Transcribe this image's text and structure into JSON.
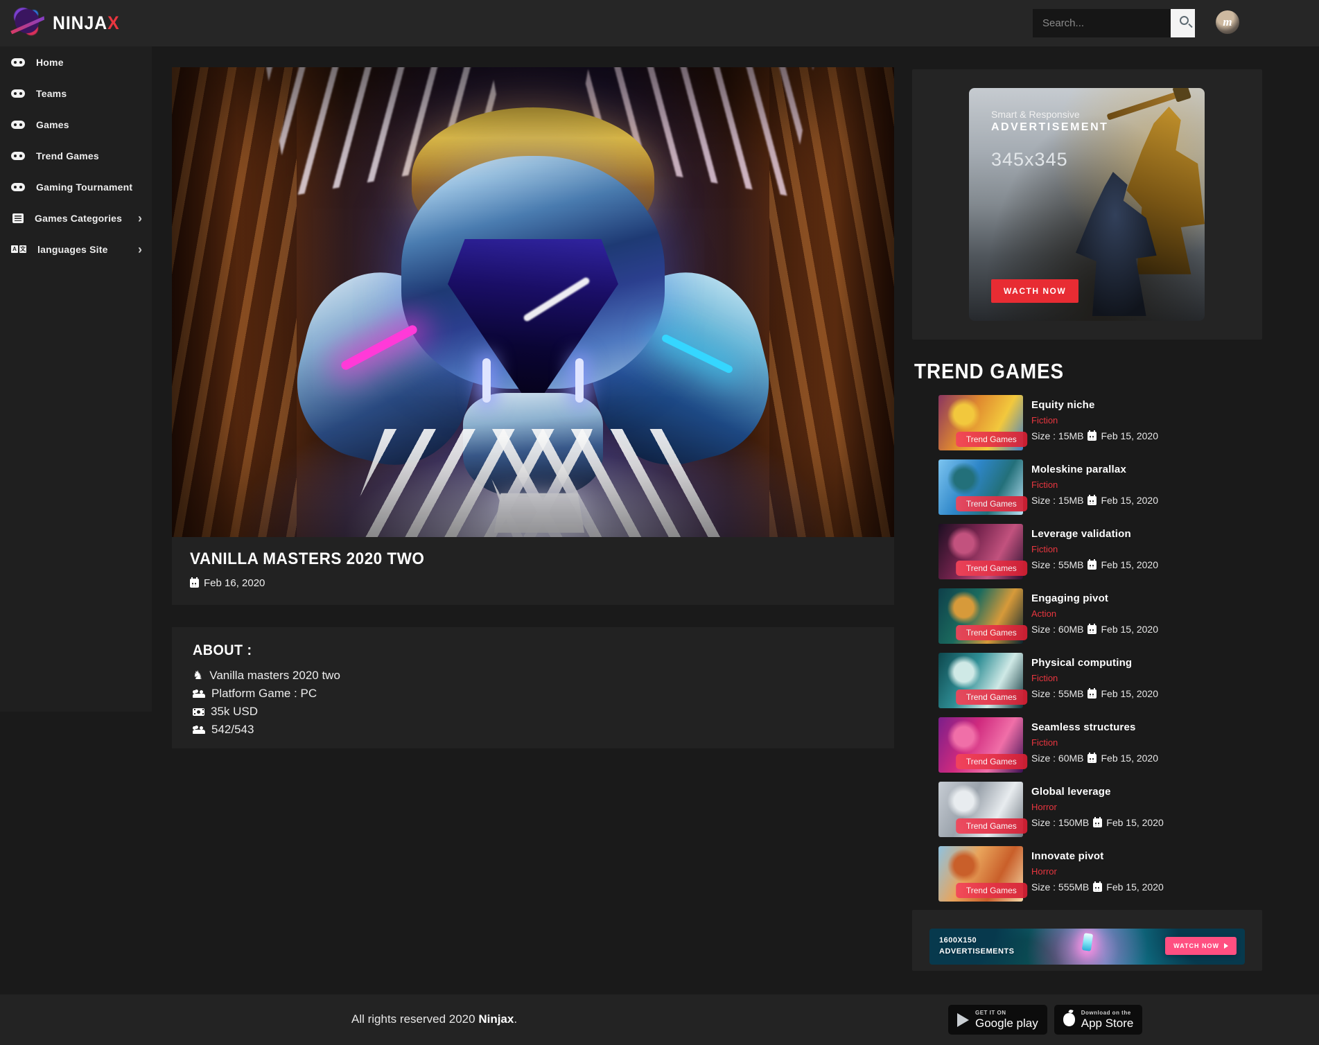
{
  "header": {
    "brand": {
      "text_main": "NINJA",
      "text_accent": "X"
    },
    "search_placeholder": "Search...",
    "avatar_initial": "m"
  },
  "sidebar": {
    "items": [
      {
        "label": "Home",
        "icon": "gamepad"
      },
      {
        "label": "Teams",
        "icon": "gamepad"
      },
      {
        "label": "Games",
        "icon": "gamepad"
      },
      {
        "label": "Trend Games",
        "icon": "gamepad"
      },
      {
        "label": "Gaming Tournament",
        "icon": "gamepad"
      },
      {
        "label": "Games Categories",
        "icon": "list",
        "has_submenu": true
      },
      {
        "label": "languages Site",
        "icon": "translate",
        "has_submenu": true
      }
    ]
  },
  "post": {
    "title": "VANILLA MASTERS 2020 TWO",
    "date": "Feb 16, 2020"
  },
  "about": {
    "heading": "ABOUT :",
    "rows": [
      {
        "icon": "chess-knight",
        "text": "Vanilla masters 2020 two"
      },
      {
        "icon": "users",
        "text": "Platform Game : PC"
      },
      {
        "icon": "money-bill",
        "text": "35k USD"
      },
      {
        "icon": "users",
        "text": "542/543"
      }
    ]
  },
  "ad": {
    "tagline": "Smart & Responsive",
    "title": "ADVERTISEMENT",
    "size_label": "345x345",
    "button": "WACTH NOW"
  },
  "trend": {
    "heading": "TREND GAMES",
    "badge": "Trend Games",
    "items": [
      {
        "title": "Equity niche",
        "genre": "Fiction",
        "size": "Size : 15MB",
        "date": "Feb 15, 2020",
        "colors": [
          "#8a3560",
          "#e08a2f",
          "#f2c83d",
          "#3f7fca"
        ]
      },
      {
        "title": "Moleskine parallax",
        "genre": "Fiction",
        "size": "Size : 15MB",
        "date": "Feb 15, 2020",
        "colors": [
          "#7cc4f0",
          "#2e86c8",
          "#23707a",
          "#b9e2f5"
        ]
      },
      {
        "title": "Leverage validation",
        "genre": "Fiction",
        "size": "Size : 55MB",
        "date": "Feb 15, 2020",
        "colors": [
          "#1c0f22",
          "#77244e",
          "#c2527e",
          "#2a1030"
        ]
      },
      {
        "title": "Engaging pivot",
        "genre": "Action",
        "size": "Size : 60MB",
        "date": "Feb 15, 2020",
        "colors": [
          "#0e3f4a",
          "#1b6b5e",
          "#d79a3a",
          "#082530"
        ]
      },
      {
        "title": "Physical computing",
        "genre": "Fiction",
        "size": "Size : 55MB",
        "date": "Feb 15, 2020",
        "colors": [
          "#0d474d",
          "#2f8e95",
          "#cfe9e6",
          "#0a3238"
        ]
      },
      {
        "title": "Seamless structures",
        "genre": "Fiction",
        "size": "Size : 60MB",
        "date": "Feb 15, 2020",
        "colors": [
          "#7a1f8a",
          "#d02a7e",
          "#f06fa8",
          "#3a0f52"
        ]
      },
      {
        "title": "Global leverage",
        "genre": "Horror",
        "size": "Size : 150MB",
        "date": "Feb 15, 2020",
        "colors": [
          "#c7cdd4",
          "#9aa2ab",
          "#e8ecef",
          "#6f7881"
        ]
      },
      {
        "title": "Innovate pivot",
        "genre": "Horror",
        "size": "Size : 555MB",
        "date": "Feb 15, 2020",
        "colors": [
          "#8ec2e0",
          "#e9a45b",
          "#c95f2a",
          "#f4d9a8"
        ]
      }
    ]
  },
  "banner": {
    "line1": "1600X150",
    "line2": "ADVERTISEMENTS",
    "button": "WATCH NOW"
  },
  "footer": {
    "text_prefix": "All rights reserved 2020 ",
    "brand": "Ninjax",
    "text_suffix": ".",
    "store_badges": [
      {
        "line1": "GET IT ON",
        "line2": "Google play"
      },
      {
        "line1": "Download on the",
        "line2": "App Store"
      }
    ]
  },
  "colors": {
    "accent_red": "#e8363f",
    "badge_gradient": [
      "#f4455a",
      "#d61f34"
    ],
    "banner_pink": "#ff4f81"
  }
}
